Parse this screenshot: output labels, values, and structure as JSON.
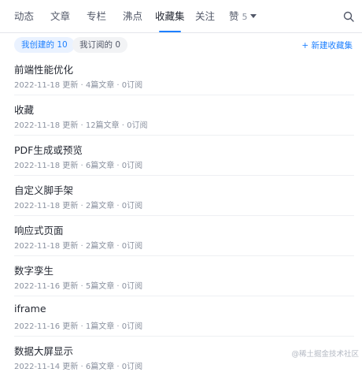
{
  "tabs": [
    {
      "label": "动态",
      "active": false
    },
    {
      "label": "文章",
      "active": false
    },
    {
      "label": "专栏",
      "active": false
    },
    {
      "label": "沸点",
      "active": false
    },
    {
      "label": "收藏集",
      "active": true
    },
    {
      "label": "关注",
      "active": false
    }
  ],
  "likes_tab": {
    "label": "赞",
    "count": "5"
  },
  "search": {
    "icon": "search-icon"
  },
  "filters": {
    "created": "我创建的 10",
    "subscribed": "我订阅的 0"
  },
  "new_collection": "+ 新建收藏集",
  "collections": [
    {
      "title": "前端性能优化",
      "meta": "2022-11-18 更新 · 4篇文章 · 0订阅"
    },
    {
      "title": "收藏",
      "meta": "2022-11-18 更新 · 12篇文章 · 0订阅"
    },
    {
      "title": "PDF生成或预览",
      "meta": "2022-11-18 更新 · 6篇文章 · 0订阅"
    },
    {
      "title": "自定义脚手架",
      "meta": "2022-11-18 更新 · 2篇文章 · 0订阅"
    },
    {
      "title": "响应式页面",
      "meta": "2022-11-18 更新 · 2篇文章 · 0订阅"
    },
    {
      "title": "数字孪生",
      "meta": "2022-11-16 更新 · 5篇文章 · 0订阅"
    },
    {
      "title": "iframe",
      "meta": "2022-11-16 更新 · 1篇文章 · 0订阅"
    },
    {
      "title": "数据大屏显示",
      "meta": "2022-11-14 更新 · 6篇文章 · 0订阅"
    }
  ],
  "watermark": "@稀土掘金技术社区",
  "colors": {
    "accent": "#1e80ff",
    "text": "#252933",
    "muted": "#8a919f"
  }
}
